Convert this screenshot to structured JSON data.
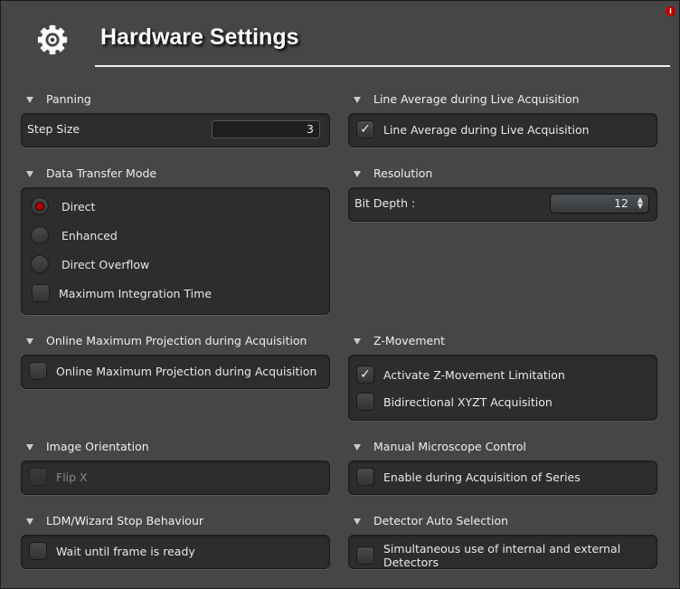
{
  "title": "Hardware Settings",
  "icons": {
    "header": "gear-icon",
    "info": "info-icon"
  },
  "accent": "#b00000",
  "panning": {
    "header": "Panning",
    "label": "Step Size",
    "value": "3"
  },
  "data_transfer": {
    "header": "Data Transfer Mode",
    "options": [
      {
        "label": "Direct",
        "selected": true
      },
      {
        "label": "Enhanced",
        "selected": false
      },
      {
        "label": "Direct Overflow",
        "selected": false
      }
    ],
    "max_integration": {
      "label": "Maximum Integration Time",
      "checked": false
    }
  },
  "online_max": {
    "header": "Online Maximum Projection during Acquisition",
    "label": "Online Maximum Projection during Acquisition",
    "checked": false
  },
  "image_orientation": {
    "header": "Image Orientation",
    "label": "Flip X",
    "checked": false,
    "disabled": true
  },
  "ldm": {
    "header": "LDM/Wizard Stop Behaviour",
    "label": "Wait until frame is ready",
    "checked": false
  },
  "line_average": {
    "header": "Line Average during Live Acquisition",
    "label": "Line Average during Live Acquisition",
    "checked": true
  },
  "resolution": {
    "header": "Resolution",
    "label": "Bit Depth :",
    "value": "12"
  },
  "z_movement": {
    "header": "Z-Movement",
    "items": [
      {
        "label": "Activate Z-Movement Limitation",
        "checked": true
      },
      {
        "label": "Bidirectional XYZT Acquisition",
        "checked": false
      }
    ]
  },
  "manual_control": {
    "header": "Manual Microscope Control",
    "label": "Enable during Acquisition of Series",
    "checked": false
  },
  "detector": {
    "header": "Detector Auto Selection",
    "label": "Simultaneous use of internal and external Detectors",
    "checked": false
  },
  "check_glyph": "✓"
}
